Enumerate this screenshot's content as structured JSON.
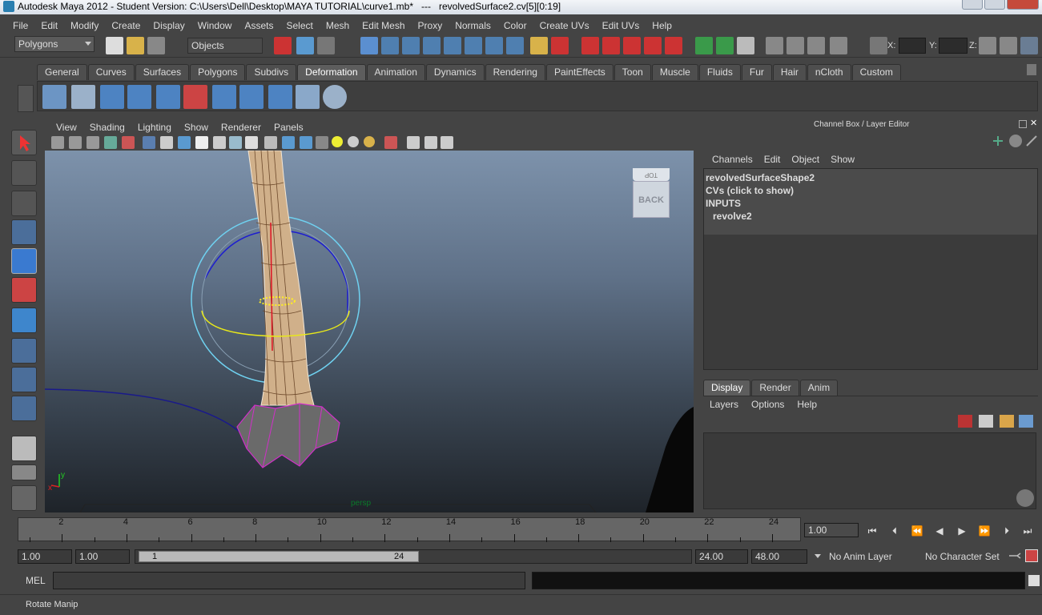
{
  "window": {
    "title": "Autodesk Maya 2012 - Student Version: C:\\Users\\Dell\\Desktop\\MAYA TUTORIAL\\curve1.mb*   ---   revolvedSurface2.cv[5][0:19]"
  },
  "menubar": {
    "items": [
      "File",
      "Edit",
      "Modify",
      "Create",
      "Display",
      "Window",
      "Assets",
      "Select",
      "Mesh",
      "Edit Mesh",
      "Proxy",
      "Normals",
      "Color",
      "Create UVs",
      "Edit UVs",
      "Help"
    ]
  },
  "statusline": {
    "menuset": "Polygons",
    "selection_mode": "Objects",
    "x_label": "X:",
    "y_label": "Y:",
    "z_label": "Z:"
  },
  "shelf": {
    "tabs": [
      "General",
      "Curves",
      "Surfaces",
      "Polygons",
      "Subdivs",
      "Deformation",
      "Animation",
      "Dynamics",
      "Rendering",
      "PaintEffects",
      "Toon",
      "Muscle",
      "Fluids",
      "Fur",
      "Hair",
      "nCloth",
      "Custom"
    ],
    "active_tab": "Deformation"
  },
  "viewport": {
    "menu": [
      "View",
      "Shading",
      "Lighting",
      "Show",
      "Renderer",
      "Panels"
    ],
    "viewcube_top": "TOP",
    "viewcube_front": "BACK",
    "camera_label": "persp",
    "axis_x": "x",
    "axis_y": "y"
  },
  "channelbox": {
    "header": "Channel Box / Layer Editor",
    "menu": [
      "Channels",
      "Edit",
      "Object",
      "Show"
    ],
    "object_name": "revolvedSurfaceShape2",
    "cvs_label": "CVs (click to show)",
    "inputs_label": "INPUTS",
    "input_node": "revolve2"
  },
  "layereditor": {
    "tabs": [
      "Display",
      "Render",
      "Anim"
    ],
    "active_tab": "Display",
    "menu": [
      "Layers",
      "Options",
      "Help"
    ]
  },
  "timeslider": {
    "tick_labels": [
      "2",
      "4",
      "6",
      "8",
      "10",
      "12",
      "14",
      "16",
      "18",
      "20",
      "22",
      "24"
    ],
    "current_time": "1.00"
  },
  "playback": {
    "buttons": [
      "go-to-start",
      "step-back-frame",
      "step-back-key",
      "play-backwards",
      "play-forwards",
      "step-forward-key",
      "step-forward-frame",
      "go-to-end"
    ]
  },
  "range": {
    "start_time": "1.00",
    "playback_start": "1.00",
    "range_start_label": "1",
    "range_end_label": "24",
    "playback_end": "24.00",
    "end_time": "48.00",
    "anim_layer": "No Anim Layer",
    "character_set": "No Character Set"
  },
  "commandline": {
    "label": "MEL"
  },
  "helpline": {
    "text": "Rotate Manip"
  }
}
